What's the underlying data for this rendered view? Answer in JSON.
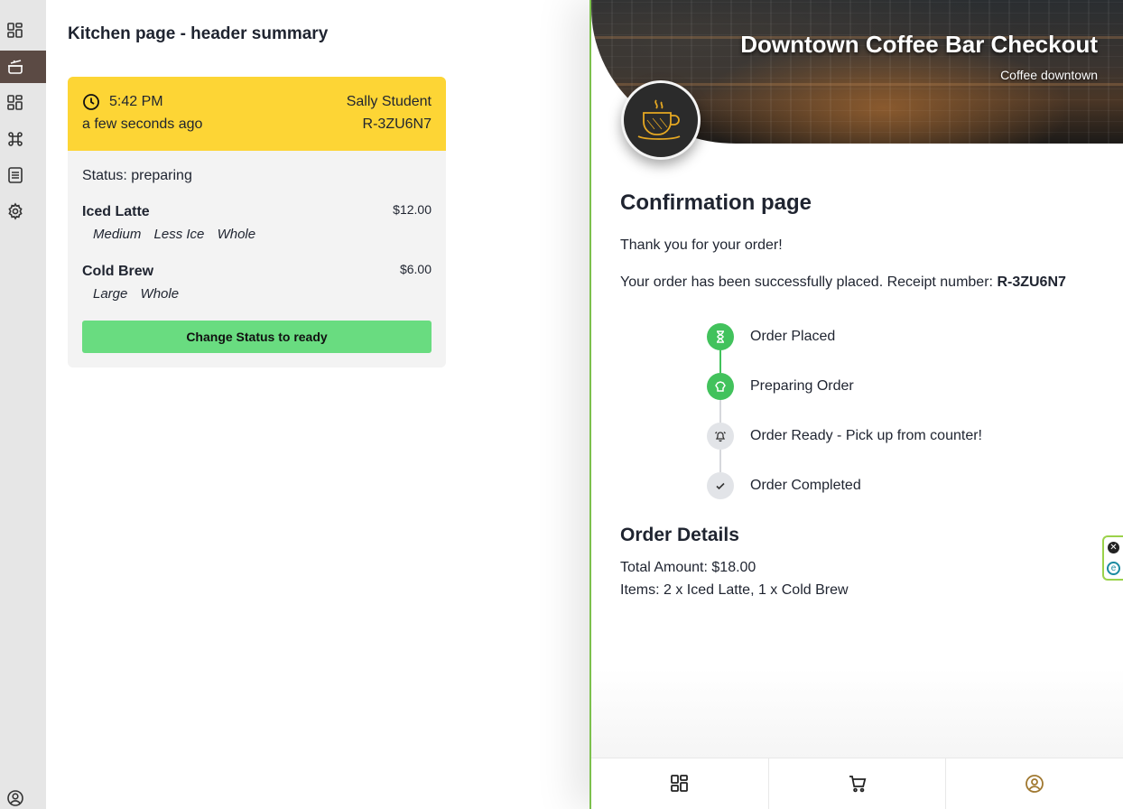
{
  "rail": {
    "items": [
      {
        "icon": "grid-icon",
        "active": false
      },
      {
        "icon": "pot-icon",
        "active": true
      },
      {
        "icon": "grid-icon",
        "active": false
      },
      {
        "icon": "command-icon",
        "active": false
      },
      {
        "icon": "list-icon",
        "active": false
      },
      {
        "icon": "gear-icon",
        "active": false
      }
    ],
    "bottom_icon": "user-circle-icon"
  },
  "kitchen": {
    "title": "Kitchen page - header summary",
    "order": {
      "time": "5:42 PM",
      "ago": "a few seconds ago",
      "customer": "Sally Student",
      "receipt": "R-3ZU6N7",
      "status": "Status: preparing",
      "items": [
        {
          "name": "Iced Latte",
          "price": "$12.00",
          "options": [
            "Medium",
            "Less Ice",
            "Whole"
          ]
        },
        {
          "name": "Cold Brew",
          "price": "$6.00",
          "options": [
            "Large",
            "Whole"
          ]
        }
      ],
      "button_label": "Change Status to ready"
    },
    "colors": {
      "header": "#fdd535",
      "button": "#69dc80"
    }
  },
  "app": {
    "hero_title": "Downtown Coffee Bar Checkout",
    "hero_subtitle": "Coffee downtown",
    "page_title": "Confirmation page",
    "thanks": "Thank you for your order!",
    "placed_text": "Your order has been successfully placed. Receipt number:",
    "receipt_number": "R-3ZU6N7",
    "steps": [
      {
        "label": "Order Placed",
        "done": true,
        "icon": "hourglass-icon"
      },
      {
        "label": "Preparing Order",
        "done": true,
        "icon": "chef-hat-icon"
      },
      {
        "label": "Order Ready - Pick up from counter!",
        "done": false,
        "icon": "bell-icon"
      },
      {
        "label": "Order Completed",
        "done": false,
        "icon": "check-icon"
      }
    ],
    "details_title": "Order Details",
    "total": "Total Amount: $18.00",
    "items_summary": "Items: 2 x Iced Latte, 1 x Cold Brew",
    "bottom_nav": [
      "grid-icon",
      "cart-icon",
      "user-circle-icon"
    ],
    "colors": {
      "step_done": "#42c25c",
      "step_todo": "#e2e4e8",
      "accent_border": "#7cc04d",
      "profile": "#a07830"
    }
  }
}
